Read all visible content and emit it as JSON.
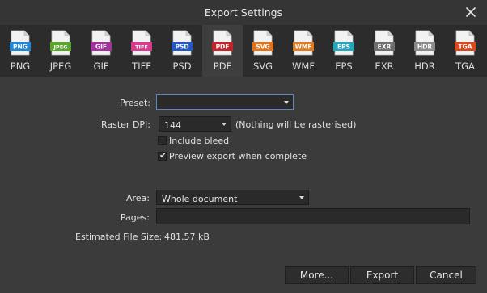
{
  "window": {
    "title": "Export Settings",
    "close_icon": "close-icon"
  },
  "formats": [
    {
      "label": "PNG",
      "icon_text": "PNG",
      "color": "#1f87d6"
    },
    {
      "label": "JPEG",
      "icon_text": "JPEG",
      "color": "#5aa52c"
    },
    {
      "label": "GIF",
      "icon_text": "GIF",
      "color": "#a3329b"
    },
    {
      "label": "TIFF",
      "icon_text": "TIFF",
      "color": "#d93a8c"
    },
    {
      "label": "PSD",
      "icon_text": "PSD",
      "color": "#2456c4"
    },
    {
      "label": "PDF",
      "icon_text": "PDF",
      "color": "#c3252b"
    },
    {
      "label": "SVG",
      "icon_text": "SVG",
      "color": "#e0731c"
    },
    {
      "label": "WMF",
      "icon_text": "WMF",
      "color": "#e07a1c"
    },
    {
      "label": "EPS",
      "icon_text": "EPS",
      "color": "#22a7b8"
    },
    {
      "label": "EXR",
      "icon_text": "EXR",
      "color": "#6f6f6f"
    },
    {
      "label": "HDR",
      "icon_text": "HDR",
      "color": "#8a8a8a"
    },
    {
      "label": "TGA",
      "icon_text": "TGA",
      "color": "#d84a1e"
    }
  ],
  "selected_format": "PDF",
  "preset": {
    "label": "Preset:",
    "value": ""
  },
  "raster_dpi": {
    "label": "Raster DPI:",
    "value": "144",
    "note": "(Nothing will be rasterised)"
  },
  "include_bleed": {
    "label": "Include bleed",
    "checked": false
  },
  "preview_export": {
    "label": "Preview export when complete",
    "checked": true
  },
  "area": {
    "label": "Area:",
    "value": "Whole document"
  },
  "pages": {
    "label": "Pages:",
    "value": ""
  },
  "file_size": {
    "label": "Estimated File Size:",
    "value": "481.57 kB"
  },
  "buttons": {
    "more": "More...",
    "export": "Export",
    "cancel": "Cancel"
  }
}
